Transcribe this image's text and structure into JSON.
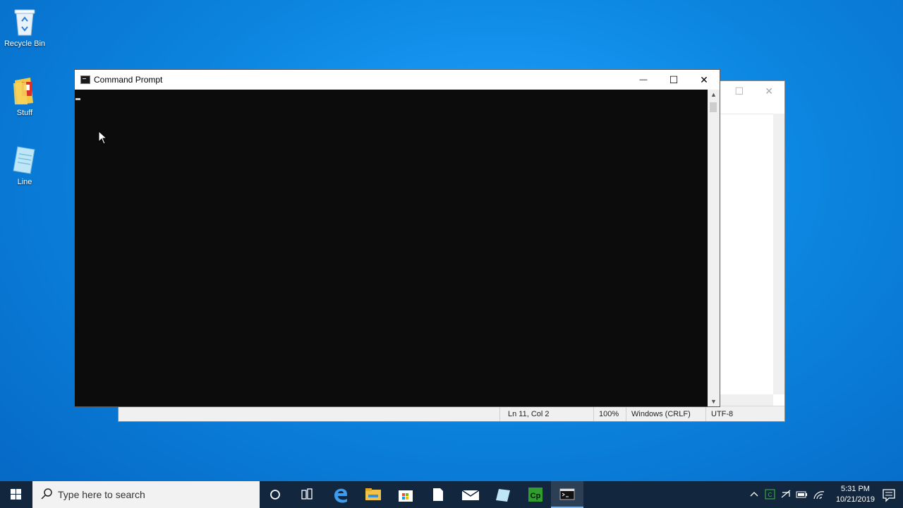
{
  "desktop": {
    "icons": [
      {
        "label": "Recycle Bin",
        "icon": "recycle-bin-icon"
      },
      {
        "label": "Stuff",
        "icon": "folder-icon"
      },
      {
        "label": "Line",
        "icon": "notepad-file-icon"
      }
    ]
  },
  "cmd_window": {
    "title": "Command Prompt",
    "minimize_glyph": "—",
    "maximize_glyph": "☐",
    "close_glyph": "✕",
    "console_bg": "#0c0c0c"
  },
  "notepad_window": {
    "status": {
      "position": "Ln 11, Col 2",
      "zoom": "100%",
      "line_ending": "Windows (CRLF)",
      "encoding": "UTF-8"
    }
  },
  "taskbar": {
    "search_placeholder": "Type here to search",
    "pinned": [
      "cortana-icon",
      "task-view-icon",
      "edge-icon",
      "file-explorer-icon",
      "store-icon",
      "file-icon",
      "mail-icon",
      "notepad-icon",
      "camtasia-icon",
      "command-prompt-icon"
    ],
    "clock": {
      "time": "5:31 PM",
      "date": "10/21/2019"
    },
    "colors": {
      "bar": "#12263e",
      "accent": "#0078d7"
    }
  }
}
